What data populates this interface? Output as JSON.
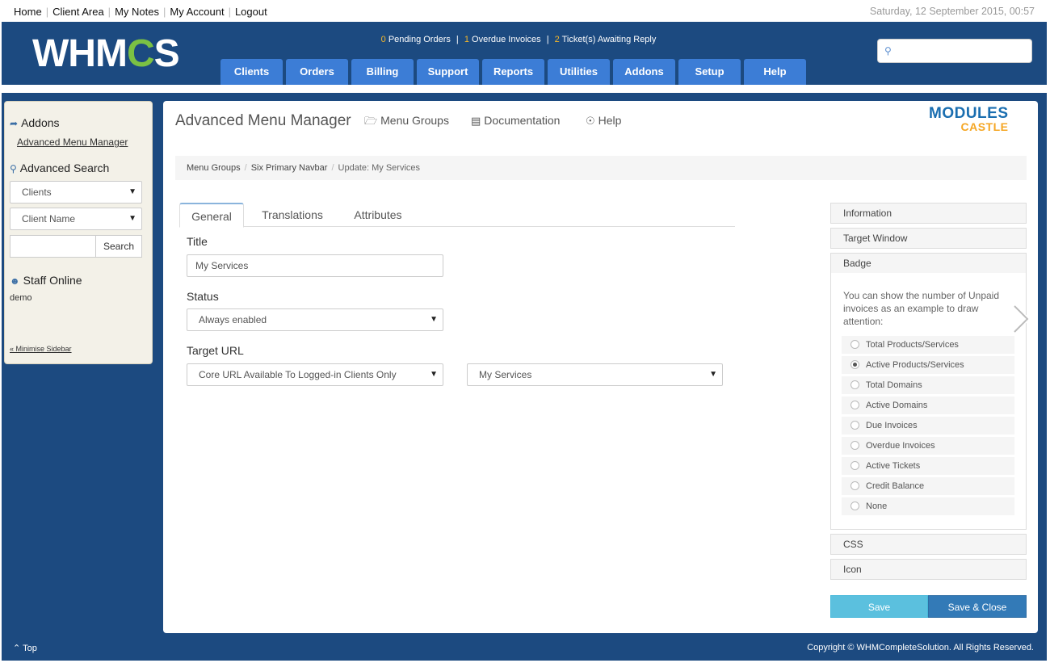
{
  "topbar": {
    "links": [
      "Home",
      "Client Area",
      "My Notes",
      "My Account",
      "Logout"
    ],
    "date": "Saturday, 12 September 2015, 00:57"
  },
  "header": {
    "logo_left": "WHM",
    "logo_gear": "C",
    "logo_right": "S",
    "stats": {
      "pending_count": "0",
      "pending_label": "Pending Orders",
      "overdue_count": "1",
      "overdue_label": "Overdue Invoices",
      "tickets_count": "2",
      "tickets_label": "Ticket(s) Awaiting Reply"
    },
    "search_placeholder": "",
    "nav": [
      "Clients",
      "Orders",
      "Billing",
      "Support",
      "Reports",
      "Utilities",
      "Addons",
      "Setup",
      "Help"
    ]
  },
  "sidebar": {
    "addons_title": "Addons",
    "addon_link": "Advanced Menu Manager",
    "adv_search_title": "Advanced Search",
    "search_type": "Clients",
    "search_field": "Client Name",
    "search_value": "",
    "search_button": "Search",
    "staff_title": "Staff Online",
    "staff_user": "demo",
    "minimise": "« Minimise Sidebar"
  },
  "main": {
    "title": "Advanced Menu Manager",
    "links": {
      "menu_groups": "Menu Groups",
      "documentation": "Documentation",
      "help": "Help"
    },
    "brand_line1": "MODULES",
    "brand_line2": "CASTLE",
    "breadcrumb": [
      "Menu Groups",
      "Six Primary Navbar",
      "Update: My Services"
    ],
    "tabs": [
      "General",
      "Translations",
      "Attributes"
    ],
    "form": {
      "title_label": "Title",
      "title_value": "My Services",
      "status_label": "Status",
      "status_value": "Always enabled",
      "url_label": "Target URL",
      "url_type": "Core URL Available To Logged-in Clients Only",
      "url_value": "My Services"
    },
    "accordion": {
      "information": "Information",
      "target_window": "Target Window",
      "badge": "Badge",
      "badge_desc": "You can show the number of Unpaid invoices as an example to draw attention:",
      "options": [
        "Total Products/Services",
        "Active Products/Services",
        "Total Domains",
        "Active Domains",
        "Due Invoices",
        "Overdue Invoices",
        "Active Tickets",
        "Credit Balance",
        "None"
      ],
      "selected_option": "Active Products/Services",
      "css": "CSS",
      "icon": "Icon"
    },
    "buttons": {
      "save": "Save",
      "save_close": "Save & Close"
    }
  },
  "footer": {
    "top": "⌃ Top",
    "copyright": "Copyright © WHMCompleteSolution. All Rights Reserved."
  },
  "colors": {
    "header_bg": "#1c4a80",
    "nav_tab": "#3c7dd6",
    "stat_highlight": "#f5b729",
    "save_btn": "#5bc0de",
    "save_close_btn": "#337ab7"
  }
}
